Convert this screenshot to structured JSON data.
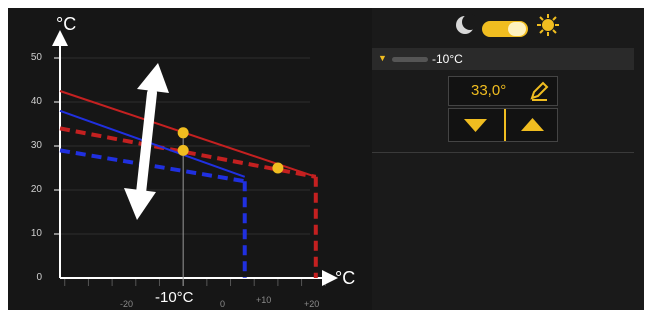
{
  "chart": {
    "y_unit": "°C",
    "x_unit": "°C",
    "y_ticks": [
      "50",
      "40",
      "30",
      "20",
      "10",
      "0"
    ],
    "x_ticks": [
      "-20",
      "0",
      "+10",
      "+20"
    ],
    "x_selected_label": "-10°C",
    "colors": {
      "red": "#c42020",
      "blue": "#2030e0",
      "marker": "#f0bd20",
      "arrow": "#ffffff"
    }
  },
  "chart_data": {
    "type": "line",
    "xlim": [
      -36,
      21
    ],
    "ylim": [
      0,
      50
    ],
    "selected_x": -10,
    "series": [
      {
        "x": [
          -36,
          18
        ],
        "y": [
          42.5,
          23
        ]
      },
      {
        "x": [
          -36,
          18
        ],
        "y": [
          34,
          23
        ]
      },
      {
        "x": [
          -36,
          3
        ],
        "y": [
          38,
          23
        ]
      },
      {
        "x": [
          -36,
          3
        ],
        "y": [
          29,
          22
        ]
      }
    ],
    "markers": [
      {
        "x": -10,
        "y": 33
      },
      {
        "x": -10,
        "y": 29
      },
      {
        "x": 10,
        "y": 25
      }
    ],
    "vertical_drops": [
      {
        "x": 3,
        "y": 22
      },
      {
        "x": 18,
        "y": 23
      }
    ]
  },
  "mode": {
    "night_icon": "moon-icon",
    "day_icon": "sun-icon",
    "toggle_state": "day"
  },
  "setpoint": {
    "band_label": "-10°C",
    "value": "33,0°",
    "edit_icon": "pencil-icon",
    "down_icon": "triangle-down-icon",
    "up_icon": "triangle-up-icon"
  }
}
